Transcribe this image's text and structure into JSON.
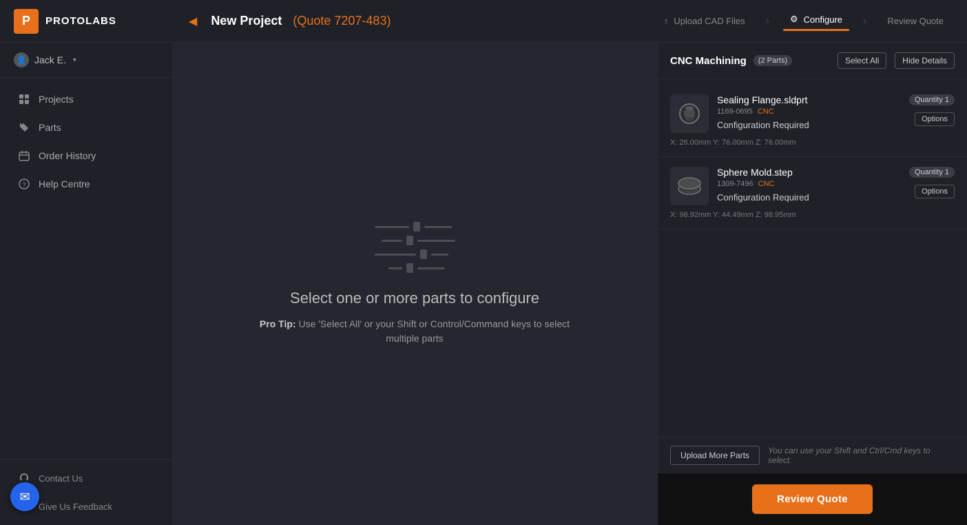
{
  "sidebar": {
    "logo_letter": "P",
    "logo_text": "PROTOLABS",
    "user": {
      "name": "Jack E.",
      "chevron": "▾"
    },
    "nav_items": [
      {
        "id": "projects",
        "label": "Projects",
        "icon": "grid"
      },
      {
        "id": "parts",
        "label": "Parts",
        "icon": "tag"
      },
      {
        "id": "order-history",
        "label": "Order History",
        "icon": "calendar"
      },
      {
        "id": "help-centre",
        "label": "Help Centre",
        "icon": "question"
      }
    ],
    "bottom_items": [
      {
        "id": "contact-us",
        "label": "Contact Us",
        "icon": "headset"
      },
      {
        "id": "give-us-feedback",
        "label": "Give Us Feedback",
        "icon": "comment"
      }
    ]
  },
  "header": {
    "back_arrow": "◀",
    "title": "New Project",
    "quote_id": "(Quote 7207-483)",
    "steps": [
      {
        "id": "upload",
        "label": "Upload CAD Files",
        "icon": "↑",
        "active": false
      },
      {
        "id": "configure",
        "label": "Configure",
        "icon": "⚙",
        "active": true
      },
      {
        "id": "review",
        "label": "Review Quote",
        "active": false
      }
    ]
  },
  "center": {
    "title": "Select one or more parts to configure",
    "pro_tip_label": "Pro Tip:",
    "pro_tip_text": "Use 'Select All' or your Shift or Control/Command keys to select multiple parts"
  },
  "right_panel": {
    "section_title": "CNC Machining",
    "parts_badge": "(2 Parts)",
    "select_all_label": "Select All",
    "hide_details_label": "Hide Details",
    "parts": [
      {
        "id": "part-1",
        "name": "Sealing Flange.sldprt",
        "part_id": "1169-0695",
        "id_suffix": "CNC",
        "status": "Configuration Required",
        "quantity_label": "Quantity 1",
        "options_label": "Options",
        "dimensions": "X: 26.00mm Y: 76.00mm Z: 76.00mm"
      },
      {
        "id": "part-2",
        "name": "Sphere Mold.step",
        "part_id": "1309-7496",
        "id_suffix": "CNC",
        "status": "Configuration Required",
        "quantity_label": "Quantity 1",
        "options_label": "Options",
        "dimensions": "X: 98.92mm Y: 44.49mm Z: 98.95mm"
      }
    ],
    "upload_more_label": "Upload More Parts",
    "upload_hint": "You can use your Shift and Ctrl/Cmd keys to select.",
    "review_quote_label": "Review Quote"
  },
  "chat_bubble_icon": "✉"
}
